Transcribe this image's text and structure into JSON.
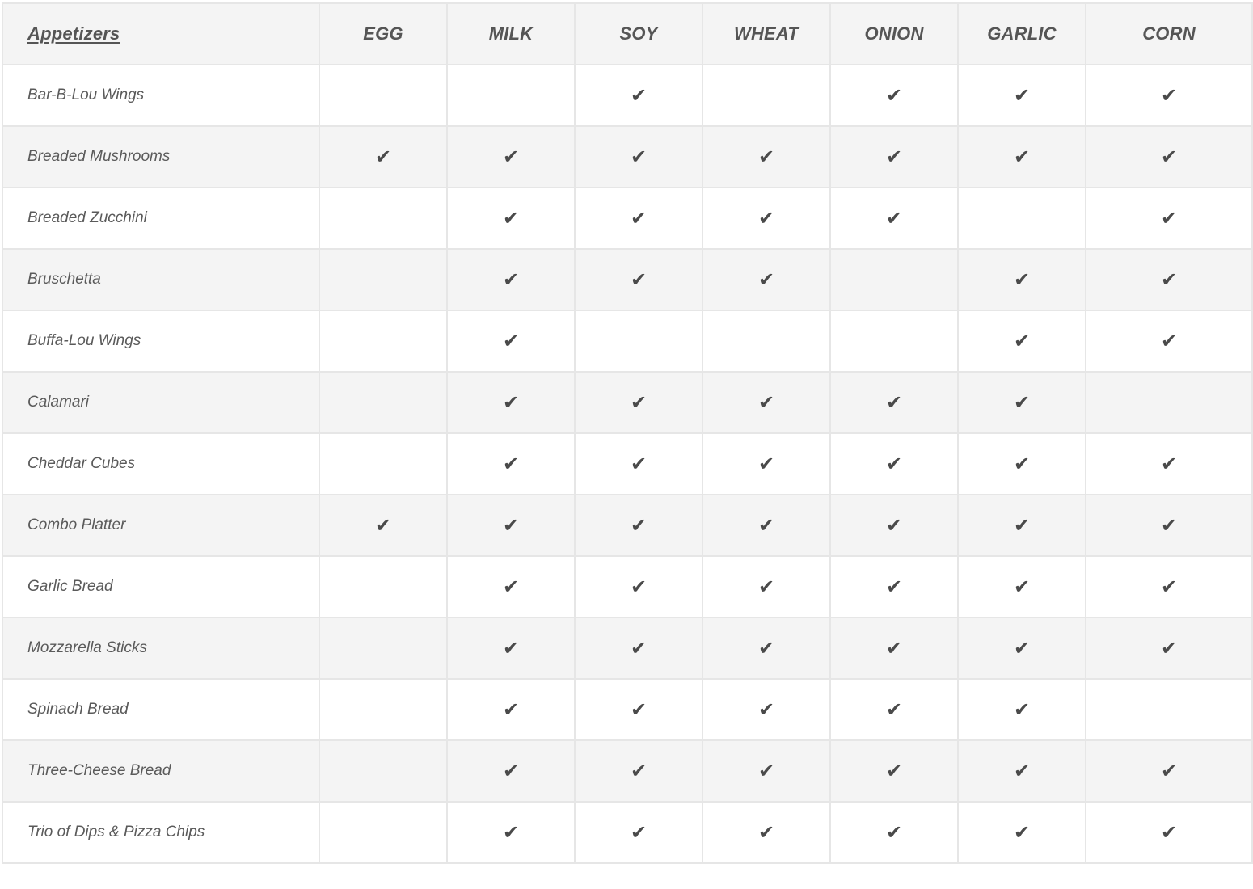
{
  "table": {
    "section_heading": "Appetizers",
    "allergens": [
      "EGG",
      "MILK",
      "SOY",
      "WHEAT",
      "ONION",
      "GARLIC",
      "CORN"
    ],
    "check_symbol": "✔",
    "rows": [
      {
        "item": "Bar-B-Lou Wings",
        "contains": [
          false,
          false,
          true,
          false,
          true,
          true,
          true
        ]
      },
      {
        "item": "Breaded Mushrooms",
        "contains": [
          true,
          true,
          true,
          true,
          true,
          true,
          true
        ]
      },
      {
        "item": "Breaded Zucchini",
        "contains": [
          false,
          true,
          true,
          true,
          true,
          false,
          true
        ]
      },
      {
        "item": "Bruschetta",
        "contains": [
          false,
          true,
          true,
          true,
          false,
          true,
          true
        ]
      },
      {
        "item": "Buffa-Lou Wings",
        "contains": [
          false,
          true,
          false,
          false,
          false,
          true,
          true
        ]
      },
      {
        "item": "Calamari",
        "contains": [
          false,
          true,
          true,
          true,
          true,
          true,
          false
        ]
      },
      {
        "item": "Cheddar Cubes",
        "contains": [
          false,
          true,
          true,
          true,
          true,
          true,
          true
        ]
      },
      {
        "item": "Combo Platter",
        "contains": [
          true,
          true,
          true,
          true,
          true,
          true,
          true
        ]
      },
      {
        "item": "Garlic Bread",
        "contains": [
          false,
          true,
          true,
          true,
          true,
          true,
          true
        ]
      },
      {
        "item": "Mozzarella Sticks",
        "contains": [
          false,
          true,
          true,
          true,
          true,
          true,
          true
        ]
      },
      {
        "item": "Spinach Bread",
        "contains": [
          false,
          true,
          true,
          true,
          true,
          true,
          false
        ]
      },
      {
        "item": "Three-Cheese Bread",
        "contains": [
          false,
          true,
          true,
          true,
          true,
          true,
          true
        ]
      },
      {
        "item": "Trio of Dips & Pizza Chips",
        "contains": [
          false,
          true,
          true,
          true,
          true,
          true,
          true
        ]
      }
    ]
  },
  "colors": {
    "header_bg": "#f4f4f4",
    "stripe_bg": "#f4f4f4",
    "grid_line": "#e6e6e6",
    "text": "#555555"
  }
}
